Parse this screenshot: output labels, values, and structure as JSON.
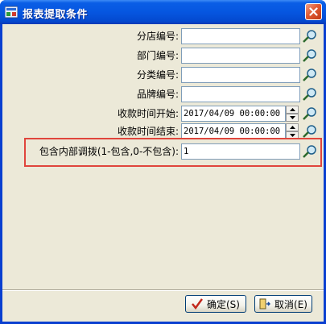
{
  "window": {
    "title": "报表提取条件"
  },
  "fields": [
    {
      "label": "分店编号:",
      "value": ""
    },
    {
      "label": "部门编号:",
      "value": ""
    },
    {
      "label": "分类编号:",
      "value": ""
    },
    {
      "label": "品牌编号:",
      "value": ""
    },
    {
      "label": "收款时间开始:",
      "value": "2017/04/09 00:00:00"
    },
    {
      "label": "收款时间结束:",
      "value": "2017/04/09 00:00:00"
    },
    {
      "label": "包含内部调拨(1-包含,0-不包含):",
      "value": "1"
    }
  ],
  "buttons": {
    "ok": "确定(S)",
    "cancel": "取消(E)"
  },
  "colors": {
    "title_bar": "#0656e0",
    "client_bg": "#ece9d8",
    "highlight": "#e0453c"
  }
}
